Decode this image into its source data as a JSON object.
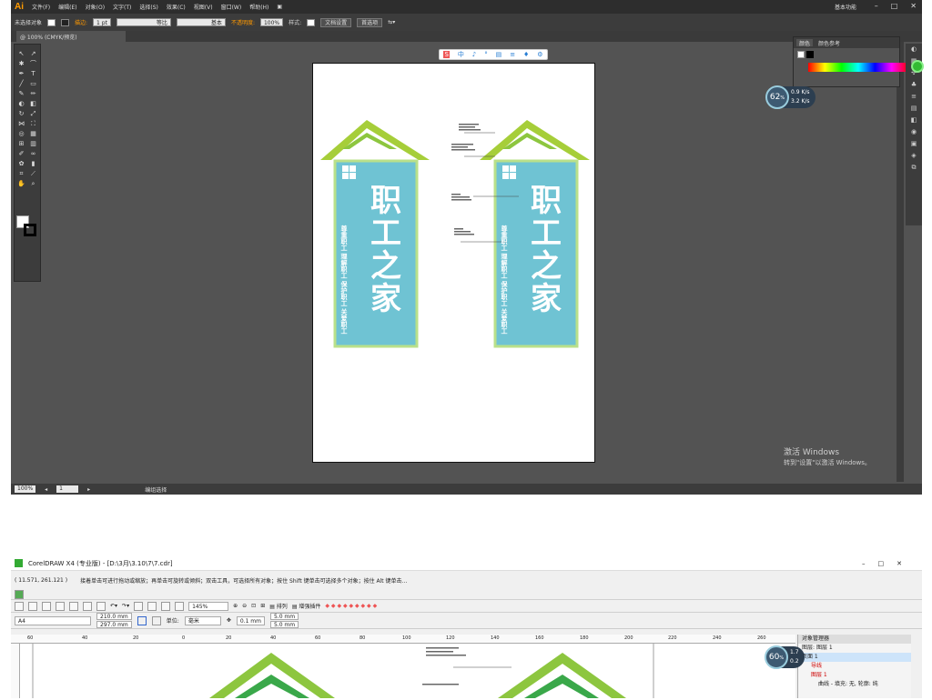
{
  "ai": {
    "logo": "Ai",
    "menu": [
      "文件(F)",
      "编辑(E)",
      "对象(O)",
      "文字(T)",
      "选择(S)",
      "效果(C)",
      "视图(V)",
      "窗口(W)",
      "帮助(H)"
    ],
    "workspace": "基本功能",
    "control": {
      "selection": "未选择对象",
      "stroke_label": "描边:",
      "stroke_weight": "1 pt",
      "profile": "等比",
      "brush": "基本",
      "opacity_label": "不透明度:",
      "opacity_value": "100%",
      "style_label": "样式:",
      "doc_setup": "文档设置",
      "preferences": "首选项"
    },
    "tab": "@ 100% (CMYK/预览)",
    "status": {
      "zoom": "100%",
      "page": "1",
      "mode": "编组选择"
    },
    "color_panel": {
      "tabs": [
        "颜色",
        "颜色参考"
      ]
    },
    "float_toolbar": [
      "中",
      "♪",
      "°",
      "▤",
      "≡",
      "♦",
      "⚙"
    ],
    "gauge": {
      "percent": "62",
      "up": "0.9",
      "down": "3.2",
      "unit": "K/s"
    },
    "activation": {
      "title": "激活 Windows",
      "sub": "转到\"设置\"以激活 Windows。"
    }
  },
  "sign": {
    "title_chars": [
      "职",
      "工",
      "之",
      "家"
    ],
    "side_text": "尊重职工 理解职工 保护职工 关爱职工",
    "colors": {
      "panel": "#6fc3d3",
      "roof": "#8dc63f",
      "roof_dark": "#5aa02c"
    }
  },
  "cd": {
    "title": "CorelDRAW X4 (专业版) - [D:\\3月\\3.10\\7\\7.cdr]",
    "coords": "( 11.571, 261.121 )",
    "hint": "接着单击可进行拖动或缩放；再单击可旋转或倾斜；双击工具，可选择所有对象；按住 Shift 键单击可选择多个对象；按住 Alt 键单击...",
    "zoom": "145%",
    "arrange": "排列",
    "plugins": "增强插件",
    "page": "A4",
    "width": "210.0 mm",
    "height": "297.0 mm",
    "unit_label": "单位:",
    "unit": "毫米",
    "nudge": "0.1 mm",
    "dup_x": "5.0 mm",
    "dup_y": "5.0 mm",
    "ruler_ticks": [
      "60",
      "40",
      "20",
      "0",
      "20",
      "40",
      "60",
      "80",
      "100",
      "120",
      "140",
      "160",
      "180",
      "200",
      "220",
      "240",
      "260"
    ],
    "obj_manager": {
      "title": "对象管理器",
      "layers_title": "图层:",
      "layer_name": "图层 1",
      "page": "页面 1",
      "guides": "导线",
      "layer1": "图层 1",
      "curve": "曲线 - 填充: 无, 轮廓: 纯"
    },
    "gauge": {
      "percent": "60",
      "up": "1.7",
      "down": "0.2"
    }
  }
}
